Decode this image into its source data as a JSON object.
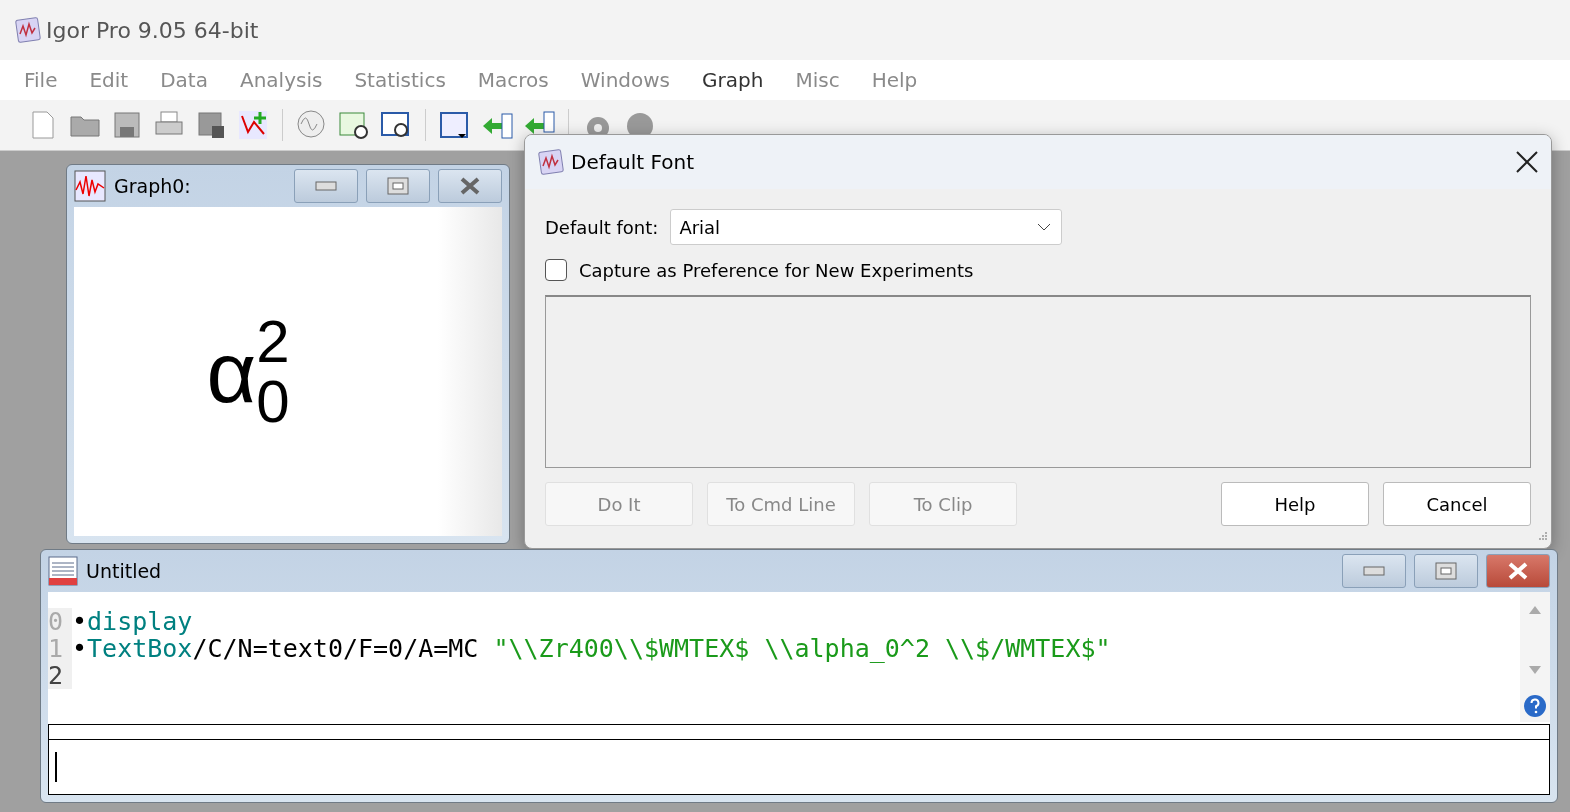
{
  "window": {
    "title": "Igor Pro 9.05 64-bit"
  },
  "menu": [
    {
      "label": "File",
      "disabled": true
    },
    {
      "label": "Edit",
      "disabled": true
    },
    {
      "label": "Data",
      "disabled": true
    },
    {
      "label": "Analysis",
      "disabled": true
    },
    {
      "label": "Statistics",
      "disabled": true
    },
    {
      "label": "Macros",
      "disabled": true
    },
    {
      "label": "Windows",
      "disabled": true
    },
    {
      "label": "Graph",
      "disabled": false
    },
    {
      "label": "Misc",
      "disabled": true
    },
    {
      "label": "Help",
      "disabled": true
    }
  ],
  "graph_window": {
    "title": "Graph0:",
    "textbox": {
      "base": "α",
      "subscript": "0",
      "superscript": "2"
    }
  },
  "dialog": {
    "title": "Default Font",
    "font_label": "Default font:",
    "font_value": "Arial",
    "capture": {
      "label": "Capture as Preference for New Experiments",
      "checked": false
    },
    "buttons": [
      {
        "label": "Do It",
        "disabled": true
      },
      {
        "label": "To Cmd Line",
        "disabled": true
      },
      {
        "label": "To Clip",
        "disabled": true
      },
      {
        "label": "Help",
        "disabled": false
      },
      {
        "label": "Cancel",
        "disabled": false
      }
    ]
  },
  "command_window": {
    "title": "Untitled",
    "lines": [
      {
        "number": "0",
        "current": false,
        "segments": [
          {
            "kind": "bullet",
            "text": "•"
          },
          {
            "kind": "keyword",
            "text": "display"
          }
        ]
      },
      {
        "number": "1",
        "current": false,
        "segments": [
          {
            "kind": "bullet",
            "text": "•"
          },
          {
            "kind": "keyword",
            "text": "TextBox"
          },
          {
            "kind": "plain",
            "text": "/C/N=text0/F=0/A=MC "
          },
          {
            "kind": "string",
            "text": "\"\\\\Zr400\\\\$WMTEX$ \\\\alpha_0^2 \\\\$/WMTEX$\""
          }
        ]
      },
      {
        "number": "2",
        "current": true
      }
    ]
  }
}
